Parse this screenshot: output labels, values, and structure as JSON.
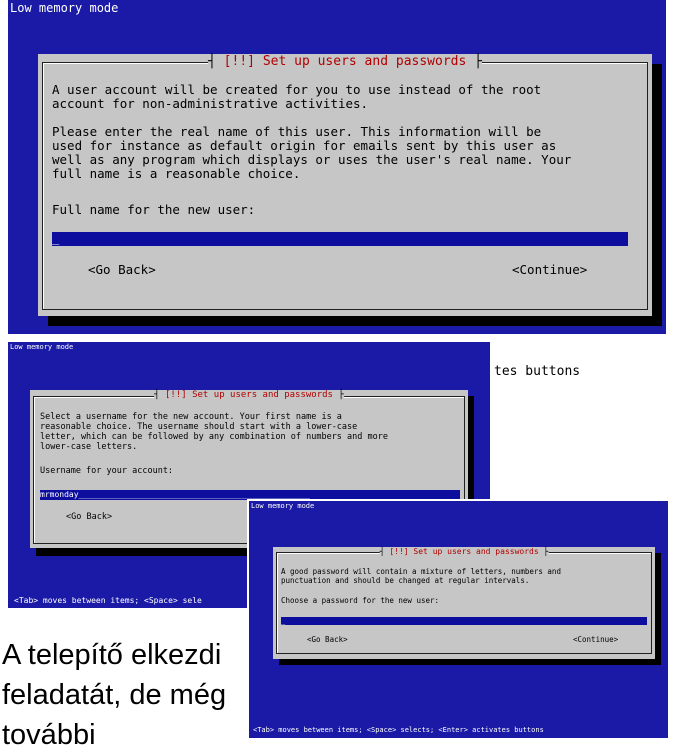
{
  "screen1": {
    "mode": "Low memory mode",
    "title": "[!!] Set up users and passwords",
    "para1": [
      "A user account will be created for you to use instead of the root",
      "account for non-administrative activities."
    ],
    "para2": [
      "Please enter the real name of this user. This information will be",
      "used for instance as default origin for emails sent by this user as",
      "well as any program which displays or uses the user's real name. Your",
      "full name is a reasonable choice."
    ],
    "prompt": "Full name for the new user:",
    "field_value": "_",
    "back": "<Go Back>",
    "continue": "<Continue>"
  },
  "screen2": {
    "mode": "Low memory mode",
    "title": "[!!] Set up users and passwords",
    "para1": [
      "Select a username for the new account. Your first name is a",
      "reasonable choice. The username should start with a lower-case",
      "letter, which can be followed by any combination of numbers and more",
      "lower-case letters."
    ],
    "prompt": "Username for your account:",
    "field_value": "mrmonday________________________________________________",
    "back": "<Go Back>",
    "status": "<Tab> moves between items; <Space> sele",
    "side_text": "tes buttons"
  },
  "screen3": {
    "mode": "Low memory mode",
    "title": "[!!] Set up users and passwords",
    "para1": [
      "A good password will contain a mixture of letters, numbers and",
      "punctuation and should be changed at regular intervals."
    ],
    "prompt": "Choose a password for the new user:",
    "field_value": "_",
    "back": "<Go Back>",
    "continue": "<Continue>",
    "status": "<Tab> moves between items; <Space> selects; <Enter> activates buttons"
  },
  "caption": [
    "A telepítő elkezdi",
    "feladatát, de még",
    "további"
  ]
}
